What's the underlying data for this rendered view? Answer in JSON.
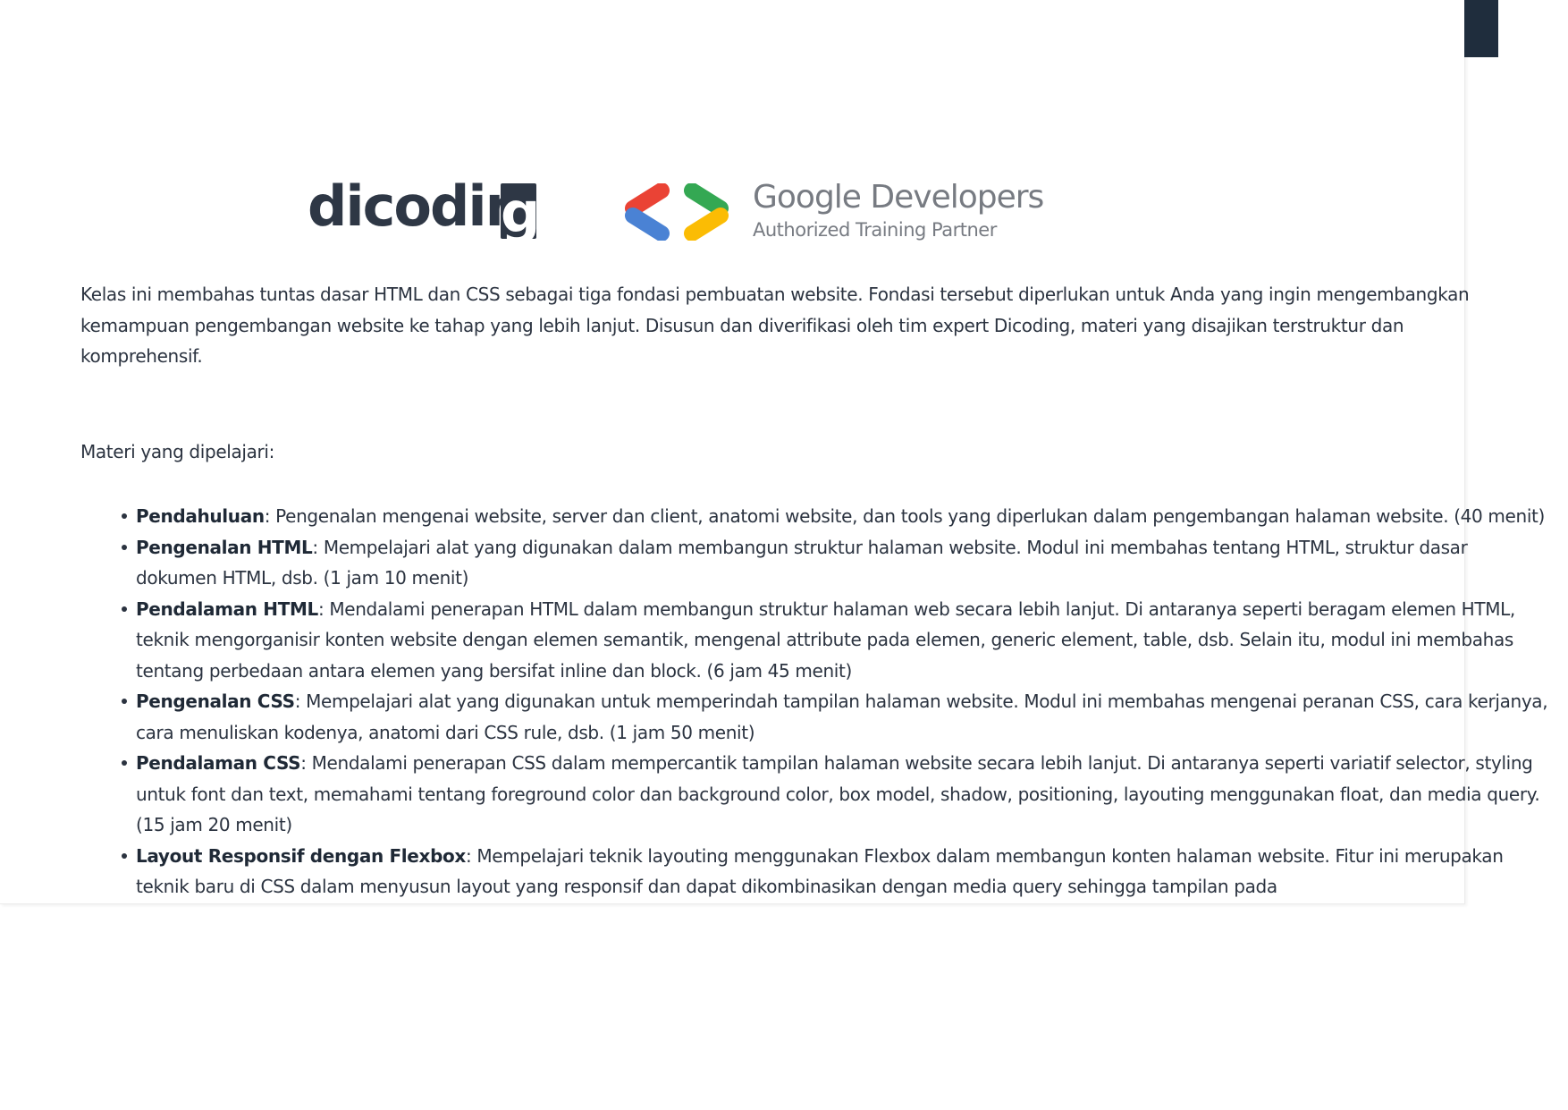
{
  "logos": {
    "dicoding": {
      "word": "dicodin",
      "g": "g",
      "color": "#2e3745"
    },
    "google_developers": {
      "title": "Google Developers",
      "subtitle": "Authorized Training Partner",
      "chevron_colors": [
        "#ea4335",
        "#4a82d4",
        "#34a853",
        "#fbbc04"
      ]
    }
  },
  "intro": "Kelas ini membahas tuntas dasar HTML dan CSS sebagai tiga fondasi pembuatan website. Fondasi tersebut diperlukan untuk Anda yang ingin mengembangkan kemampuan pengembangan website ke tahap yang lebih lanjut. Disusun dan diverifikasi oleh tim expert Dicoding, materi yang disajikan terstruktur dan komprehensif.",
  "materi_label": "Materi yang dipelajari:",
  "topics": [
    {
      "title": "Pendahuluan",
      "desc": ": Pengenalan mengenai website, server dan client, anatomi website, dan tools yang diperlukan dalam pengembangan halaman website. (40 menit)"
    },
    {
      "title": "Pengenalan HTML",
      "desc": ": Mempelajari alat yang digunakan dalam membangun struktur halaman website. Modul ini membahas tentang HTML, struktur dasar dokumen HTML, dsb. (1 jam 10 menit)"
    },
    {
      "title": "Pendalaman HTML",
      "desc": ": Mendalami penerapan HTML dalam membangun struktur halaman web secara lebih lanjut. Di antaranya seperti beragam elemen HTML, teknik mengorganisir konten website dengan elemen semantik, mengenal attribute pada elemen, generic element, table, dsb. Selain itu, modul ini membahas tentang perbedaan antara elemen yang bersifat inline dan block. (6 jam 45 menit)"
    },
    {
      "title": "Pengenalan CSS",
      "desc": ": Mempelajari alat yang digunakan untuk memperindah tampilan halaman website. Modul ini membahas mengenai peranan CSS, cara kerjanya, cara menuliskan kodenya, anatomi dari CSS rule, dsb. (1 jam 50 menit)"
    },
    {
      "title": "Pendalaman CSS",
      "desc": ": Mendalami penerapan CSS dalam mempercantik tampilan halaman website secara lebih lanjut. Di antaranya seperti variatif selector, styling untuk font dan text, memahami tentang foreground color dan background color, box model, shadow, positioning, layouting menggunakan float, dan media query. (15 jam 20 menit)"
    },
    {
      "title": "Layout Responsif dengan Flexbox",
      "desc": ": Mempelajari teknik layouting menggunakan Flexbox dalam membangun konten halaman website. Fitur ini merupakan teknik baru di CSS dalam menyusun layout yang responsif dan dapat dikombinasikan dengan media query sehingga tampilan pada"
    }
  ]
}
